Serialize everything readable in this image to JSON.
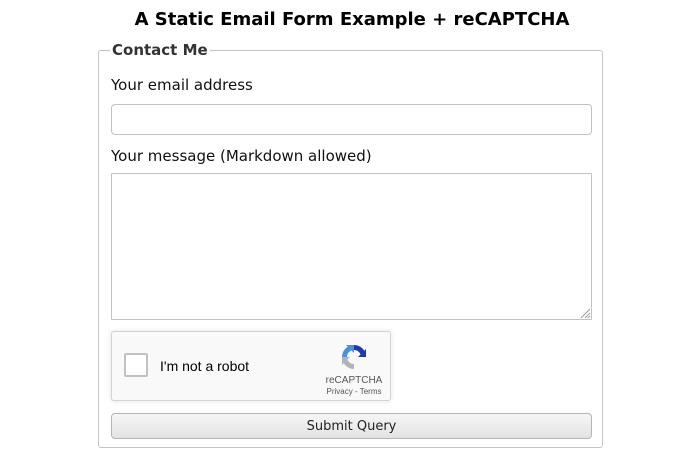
{
  "page": {
    "title": "A Static Email Form Example + reCAPTCHA"
  },
  "form": {
    "legend": "Contact Me",
    "email_label": "Your email address",
    "email_value": "",
    "message_label": "Your message (Markdown allowed)",
    "message_value": "",
    "submit_label": "Submit Query"
  },
  "captcha": {
    "checkbox_checked": false,
    "label": "I'm not a robot",
    "brand": "reCAPTCHA",
    "privacy": "Privacy",
    "separator": " - ",
    "terms": "Terms",
    "logo_icon": "recaptcha-logo-icon"
  },
  "colors": {
    "recaptcha_blue": "#1c3aa9",
    "recaptcha_light_blue": "#4a90e2",
    "recaptcha_gray": "#b3b3b3"
  }
}
